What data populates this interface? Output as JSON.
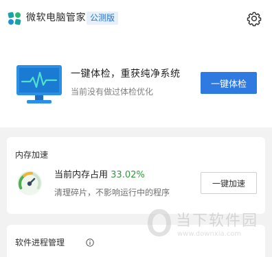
{
  "header": {
    "app_title": "微软电脑管家",
    "badge": "公测版",
    "settings_icon": "gear-icon"
  },
  "health_check": {
    "title": "一键体检，重获纯净系统",
    "subtitle": "当前没有做过体检优化",
    "button_label": "一键体检",
    "icon": "monitor-heartbeat-icon"
  },
  "memory": {
    "section_title": "内存加速",
    "usage_label": "当前内存占用",
    "usage_value": "33.02%",
    "usage_fraction": 0.3302,
    "description": "清理碎片，不影响运行中的程序",
    "button_label": "一键加速",
    "icon": "gauge-icon"
  },
  "process": {
    "section_title": "软件进程管理",
    "info_icon": "info-icon"
  },
  "watermark": {
    "text_cn": "当下软件园",
    "url": "www.downxia.com"
  },
  "colors": {
    "accent": "#2e7ae0",
    "success": "#2f9a3c",
    "background": "#f2f2f2"
  }
}
